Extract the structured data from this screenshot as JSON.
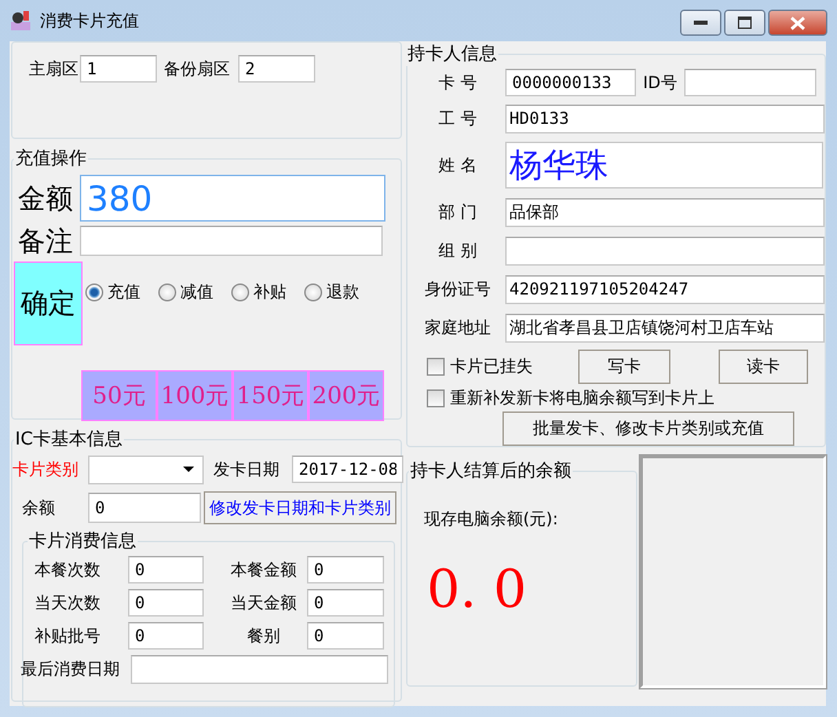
{
  "window": {
    "title": "消费卡片充值"
  },
  "sectors": {
    "fields": [
      {
        "label": "主扇区",
        "value": "1"
      },
      {
        "label": "备份扇区",
        "value": "2"
      }
    ]
  },
  "recharge": {
    "title": "充值操作",
    "amount": {
      "label": "金额",
      "value": "380"
    },
    "note": {
      "label": "备注"
    },
    "confirm": "确定",
    "modes": [
      {
        "label": "充值",
        "selected": true
      },
      {
        "label": "减值",
        "selected": false
      },
      {
        "label": "补贴",
        "selected": false
      },
      {
        "label": "退款",
        "selected": false
      }
    ],
    "presets": [
      "50元",
      "100元",
      "150元",
      "200元"
    ]
  },
  "card_info": {
    "title": "IC卡基本信息",
    "type_label": "卡片类别",
    "issue_date": {
      "label": "发卡日期",
      "value": "2017-12-08"
    },
    "balance": {
      "label": "余额",
      "value": "0"
    },
    "modify_button": "修改发卡日期和卡片类别",
    "consumption": {
      "title": "卡片消费信息",
      "fields": [
        {
          "label": "本餐次数",
          "value": "0"
        },
        {
          "label": "本餐金额",
          "value": "0"
        },
        {
          "label": "当天次数",
          "value": "0"
        },
        {
          "label": "当天金额",
          "value": "0"
        },
        {
          "label": "补贴批号",
          "value": "0"
        },
        {
          "label": "餐别",
          "value": "0"
        }
      ],
      "last_date_label": "最后消费日期"
    }
  },
  "holder": {
    "title": "持卡人信息",
    "card_no": {
      "label": "卡 号",
      "value": "0000000133"
    },
    "id_no": {
      "label": "ID号"
    },
    "fields": [
      {
        "kind": "text",
        "label": "工 号",
        "value": "HD0133"
      },
      {
        "kind": "large",
        "label": "姓 名",
        "value": "杨华珠"
      },
      {
        "kind": "text",
        "label": "部 门",
        "value": "品保部"
      },
      {
        "kind": "text",
        "label": "组 别"
      },
      {
        "kind": "text",
        "label": "身份证号",
        "value": "420921197105204247"
      },
      {
        "kind": "text",
        "label": "家庭地址",
        "value": "湖北省孝昌县卫店镇饶河村卫店车站"
      }
    ],
    "lost": {
      "label": "卡片已挂失",
      "checked": false
    },
    "reissue": {
      "label": "重新补发新卡将电脑余额写到卡片上",
      "checked": false
    },
    "buttons": [
      "写卡",
      "读卡"
    ],
    "batch_button": "批量发卡、修改卡片类别或充值"
  },
  "settlement": {
    "title": "持卡人结算后的余额",
    "label": "现存电脑余额(元):",
    "value": "0. 0"
  }
}
